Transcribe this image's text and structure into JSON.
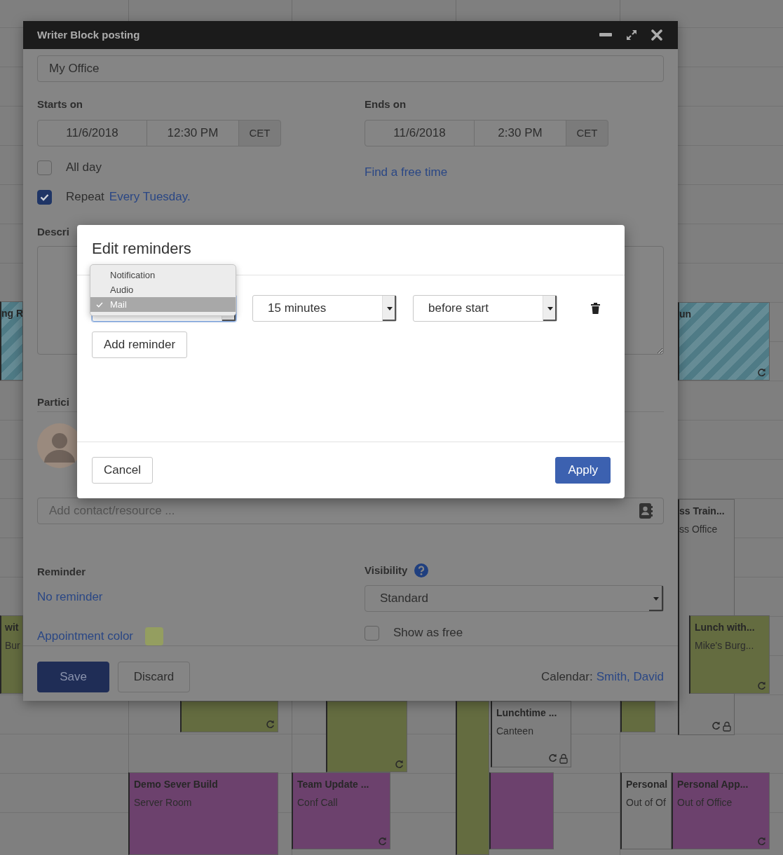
{
  "calendar": {
    "events": [
      {
        "title": "ng R",
        "color": "#4f7b86",
        "striped": true,
        "recurring": false,
        "private": false
      },
      {
        "title": "un",
        "color": "#4f7b86",
        "striped": true,
        "recurring": true,
        "private": false
      },
      {
        "title": "ss Train...",
        "subtitle": "ss Office",
        "color": "#7e7e7e",
        "striped": false,
        "recurring": true,
        "private": true
      },
      {
        "title": "wit",
        "subtitle": "Bur",
        "color": "#646c40",
        "striped": false,
        "recurring": false,
        "private": false
      },
      {
        "title": "Lunch with...",
        "subtitle": "Mike's Burg...",
        "color": "#646c40",
        "striped": false,
        "recurring": true,
        "private": false
      },
      {
        "color": "#646c40",
        "striped": false,
        "recurring": true,
        "private": false
      },
      {
        "color": "#646c40",
        "striped": false,
        "recurring": true,
        "private": false
      },
      {
        "color": "#646c40",
        "striped": false,
        "recurring": false,
        "private": false
      },
      {
        "title": "Lunchtime ...",
        "subtitle": "Canteen",
        "color": "#7e7e7e",
        "striped": false,
        "recurring": true,
        "private": true
      },
      {
        "color": "#646c40",
        "striped": false,
        "recurring": false,
        "private": false
      },
      {
        "title": "Demo Sever Build",
        "subtitle": "Server Room",
        "color": "#6c416d",
        "striped": false,
        "recurring": false,
        "private": false
      },
      {
        "title": "Team Update ...",
        "subtitle": "Conf Call",
        "color": "#6c416d",
        "striped": false,
        "recurring": true,
        "private": false
      },
      {
        "color": "#6c416d",
        "striped": false,
        "recurring": false,
        "private": false
      },
      {
        "title": "Personal",
        "subtitle": "Out of Of",
        "color": "#7e7e7e",
        "striped": false,
        "recurring": false,
        "private": false
      },
      {
        "title": "Personal App...",
        "subtitle": "Out of Office",
        "color": "#6c416d",
        "striped": false,
        "recurring": true,
        "private": false
      }
    ]
  },
  "editor_window": {
    "title": "Writer Block posting",
    "location": {
      "value": "My Office"
    },
    "starts": {
      "label": "Starts on",
      "date": "11/6/2018",
      "time": "12:30 PM",
      "timezone": "CET"
    },
    "ends": {
      "label": "Ends on",
      "date": "11/6/2018",
      "time": "2:30 PM",
      "timezone": "CET"
    },
    "all_day": {
      "label": "All day",
      "checked": false
    },
    "repeat": {
      "label": "Repeat",
      "checked": true,
      "link": "Every Tuesday."
    },
    "find_free_time": "Find a free time",
    "description": {
      "label": "Descri"
    },
    "participants": {
      "label": "Partici"
    },
    "add_contact": {
      "placeholder": "Add contact/resource ..."
    },
    "reminder": {
      "label": "Reminder",
      "value": "No reminder"
    },
    "visibility": {
      "label": "Visibility",
      "value": "Standard"
    },
    "appointment_color": {
      "label": "Appointment color",
      "color": "#949e60"
    },
    "show_as_free": {
      "label": "Show as free",
      "checked": false
    },
    "buttons": [
      {
        "label": "Save",
        "kind": "primary"
      },
      {
        "label": "Discard",
        "kind": "secondary"
      }
    ],
    "calendar": {
      "label": "Calendar:",
      "owner": "Smith, David"
    }
  },
  "reminders_dialog": {
    "title": "Edit reminders",
    "reminders": [
      {
        "type_options": [
          {
            "label": "Notification",
            "selected": false
          },
          {
            "label": "Audio",
            "selected": false
          },
          {
            "label": "Mail",
            "selected": true
          }
        ],
        "amount": "15 minutes",
        "relation": "before start"
      }
    ],
    "add_button": "Add reminder",
    "cancel": "Cancel",
    "apply": "Apply"
  }
}
